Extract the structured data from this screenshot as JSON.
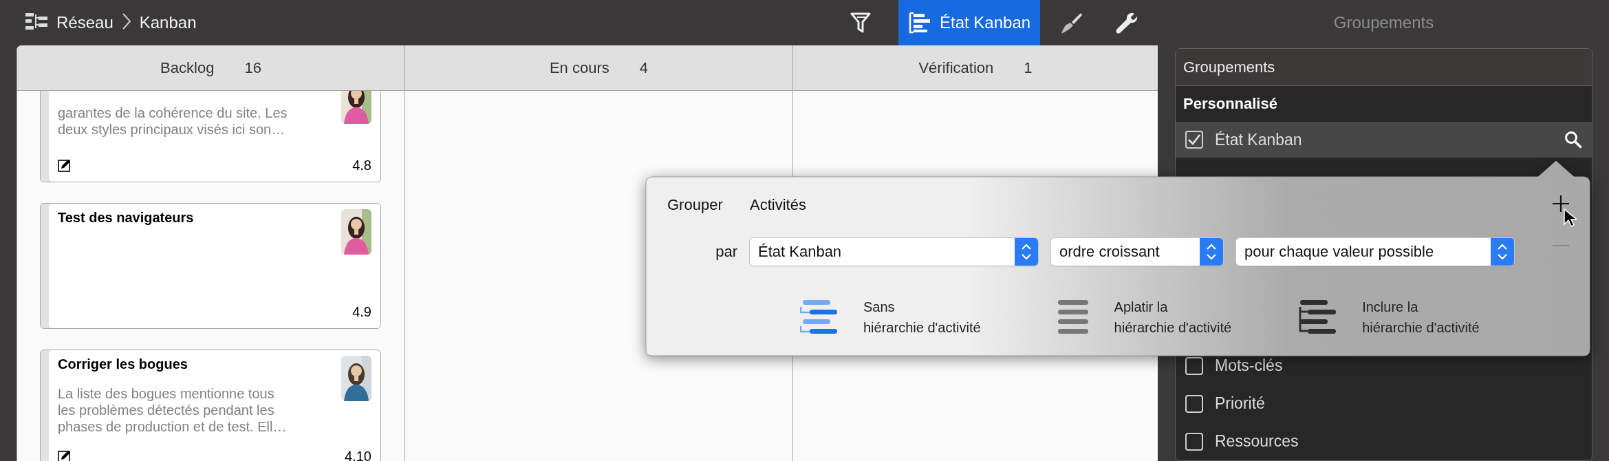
{
  "breadcrumb": [
    {
      "label": "Réseau"
    },
    {
      "label": "Kanban"
    }
  ],
  "toolbar": [
    {
      "kind": "filter",
      "selected": false
    },
    {
      "kind": "grouping",
      "label": "État Kanban",
      "selected": true
    },
    {
      "kind": "style",
      "selected": false
    },
    {
      "kind": "tools",
      "selected": false
    }
  ],
  "inspector": {
    "title": "Groupements"
  },
  "board": {
    "columns": [
      {
        "title": "Backlog",
        "count": "16",
        "cards": [
          {
            "description": [
              "garantes de la cohérence du site. Les",
              "deux styles principaux visés ici son…"
            ],
            "has_note": true,
            "number": "4.8",
            "avatar": {
              "kind": "picture"
            }
          },
          {
            "title": "Test des navigateurs",
            "has_note": false,
            "number": "4.9",
            "avatar": {
              "kind": "picture"
            }
          },
          {
            "title": "Corriger les bogues",
            "description": [
              "La liste des bogues mentionne tous",
              "les problèmes détectés pendant les",
              "phases de production et de test. Ell…"
            ],
            "has_note": true,
            "number": "4.10",
            "avatar": {
              "kind": "picture"
            }
          }
        ]
      },
      {
        "title": "En cours",
        "count": "4"
      },
      {
        "title": "Vérification",
        "count": "1"
      }
    ]
  },
  "groups_panel": {
    "title": "Groupements",
    "sections": [
      {
        "heading": "Personnalisé",
        "items": [
          {
            "label": "État Kanban",
            "checked": true,
            "selected": true
          }
        ]
      },
      {
        "items": [
          {
            "label": "Mots-clés",
            "checked": false,
            "selected": false
          },
          {
            "label": "Priorité",
            "checked": false,
            "selected": false
          },
          {
            "label": "Ressources",
            "checked": false,
            "selected": false
          }
        ]
      }
    ]
  },
  "group_popover": {
    "label": "Grouper",
    "target": "Activités",
    "by_label": "par",
    "selects": [
      {
        "value": "État Kanban"
      },
      {
        "value": "ordre croissant"
      },
      {
        "value": "pour chaque valeur possible"
      }
    ],
    "remove_disabled": true,
    "options": [
      {
        "kind": "none",
        "lines": [
          "Sans",
          "hiérarchie d'activité"
        ],
        "selected": true
      },
      {
        "kind": "flatten",
        "lines": [
          "Aplatir la",
          "hiérarchie d'activité"
        ],
        "selected": false
      },
      {
        "kind": "include",
        "lines": [
          "Inclure la",
          "hiérarchie d'activité"
        ],
        "selected": false
      }
    ]
  }
}
